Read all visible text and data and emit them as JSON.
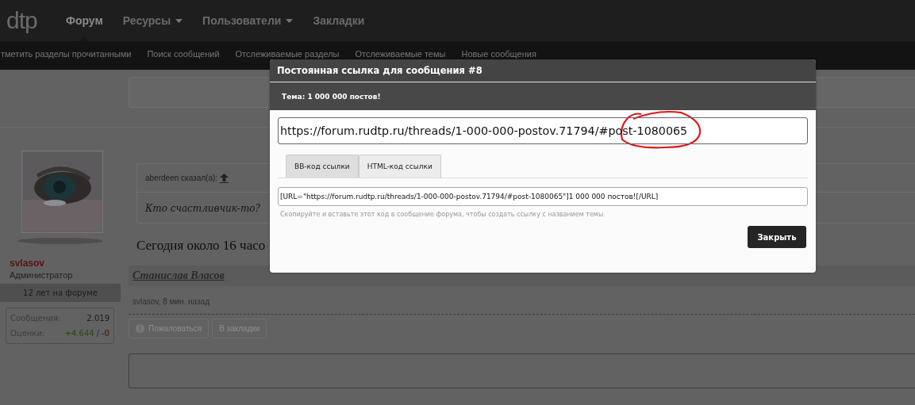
{
  "nav": {
    "logo": "dtp",
    "tabs": [
      {
        "label": "Форум",
        "selected": true,
        "has_menu": false
      },
      {
        "label": "Ресурсы",
        "selected": false,
        "has_menu": true
      },
      {
        "label": "Пользователи",
        "selected": false,
        "has_menu": true
      },
      {
        "label": "Закладки",
        "selected": false,
        "has_menu": false
      }
    ],
    "sublinks": [
      "тметить разделы прочитанными",
      "Поиск сообщений",
      "Отслеживаемые разделы",
      "Отслеживаемые темы",
      "Новые сообщения"
    ]
  },
  "user": {
    "name": "svlasov",
    "role": "Администратор",
    "tenure": "12 лет на форуме",
    "stats": [
      {
        "label": "Сообщения:",
        "value": "2.019"
      }
    ],
    "ratings": {
      "label": "Оценки:",
      "positive": "+4.644",
      "separator": "/",
      "negative": "-0"
    }
  },
  "post": {
    "quote": {
      "author": "aberdeen сказал(а):",
      "text": "Кто счастливчик-то?"
    },
    "text": "Сегодня около 16 часо",
    "signature": "Станислав Власов",
    "meta": "svlasov, 8 мин. назад",
    "actions": [
      {
        "label": "Пожаловаться",
        "kind": "report"
      },
      {
        "label": "В закладки",
        "kind": "plain"
      }
    ]
  },
  "modal": {
    "title": "Постоянная ссылка для сообщения #8",
    "subtitle": "Тема: 1 000 000 постов!",
    "url": "https://forum.rudtp.ru/threads/1-000-000-postov.71794/#post-1080065",
    "annotation": true,
    "tabs": [
      {
        "label": "BB-код ссылки",
        "selected": true
      },
      {
        "label": "HTML-код ссылки",
        "selected": false
      }
    ],
    "code": "[URL=\"https://forum.rudtp.ru/threads/1-000-000-postov.71794/#post-1080065\"]1 000 000 постов![/URL]",
    "hint": "Скопируйте и вставьте этот код в сообщение форума, чтобы создать ссылку с названием темы.",
    "close_button": "Закрыть"
  }
}
